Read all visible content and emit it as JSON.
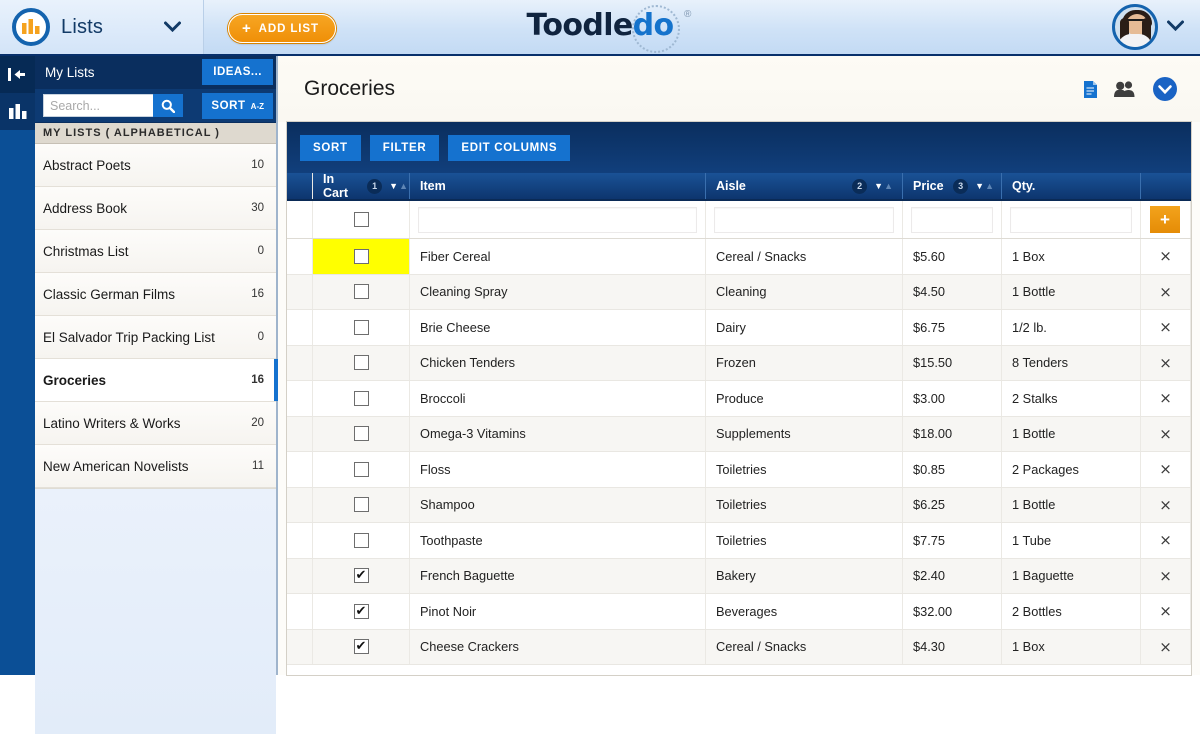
{
  "topbar": {
    "lists_label": "Lists",
    "lists_icon": "bar-chart-icon",
    "caret_icon": "chevron-down-icon",
    "add_list_label": "ADD LIST",
    "add_list_plus": "+",
    "brand_part1": "Toodle",
    "brand_part2": "do",
    "brand_registered": "®",
    "avatar_caret": "chevron-down-icon"
  },
  "rail": {
    "collapse_icon": "collapse-sidebar-icon",
    "charts_icon": "bar-chart-icon"
  },
  "sidebar": {
    "header_title": "My Lists",
    "ideas_label": "IDEAS...",
    "search_placeholder": "Search...",
    "search_value": "",
    "search_icon": "search-icon",
    "sort_label": "SORT",
    "sort_direction": "A-Z",
    "section_label": "MY LISTS ( ALPHABETICAL )",
    "items": [
      {
        "label": "Abstract Poets",
        "count": "10",
        "selected": false
      },
      {
        "label": "Address Book",
        "count": "30",
        "selected": false
      },
      {
        "label": "Christmas List",
        "count": "0",
        "selected": false
      },
      {
        "label": "Classic German Films",
        "count": "16",
        "selected": false
      },
      {
        "label": "El Salvador Trip Packing List",
        "count": "0",
        "selected": false
      },
      {
        "label": "Groceries",
        "count": "16",
        "selected": true
      },
      {
        "label": "Latino Writers & Works",
        "count": "20",
        "selected": false
      },
      {
        "label": "New American Novelists",
        "count": "11",
        "selected": false
      }
    ]
  },
  "main": {
    "page_title": "Groceries",
    "head_icons": [
      {
        "name": "notes-icon"
      },
      {
        "name": "share-people-icon"
      },
      {
        "name": "expand-options-icon"
      }
    ],
    "toolbar": {
      "sort_label": "SORT",
      "filter_label": "FILTER",
      "edit_columns_label": "EDIT COLUMNS"
    },
    "table": {
      "columns": [
        {
          "label": "In Cart",
          "badge": "1",
          "sort": "desc"
        },
        {
          "label": "Item",
          "badge": "",
          "sort": "none"
        },
        {
          "label": "Aisle",
          "badge": "2",
          "sort": "desc"
        },
        {
          "label": "Price",
          "badge": "3",
          "sort": "desc"
        },
        {
          "label": "Qty.",
          "badge": "",
          "sort": "none"
        }
      ],
      "new_row": {
        "item_value": "",
        "aisle_value": "",
        "price_value": "",
        "qty_value": "",
        "checked": false,
        "add_label": "+"
      },
      "delete_glyph": "×",
      "checked_glyph": "✔",
      "rows": [
        {
          "checked": false,
          "highlight": true,
          "item": "Fiber Cereal",
          "aisle": "Cereal / Snacks",
          "price": "$5.60",
          "qty": "1 Box"
        },
        {
          "checked": false,
          "highlight": false,
          "item": "Cleaning Spray",
          "aisle": "Cleaning",
          "price": "$4.50",
          "qty": "1 Bottle"
        },
        {
          "checked": false,
          "highlight": false,
          "item": "Brie Cheese",
          "aisle": "Dairy",
          "price": "$6.75",
          "qty": "1/2 lb."
        },
        {
          "checked": false,
          "highlight": false,
          "item": "Chicken Tenders",
          "aisle": "Frozen",
          "price": "$15.50",
          "qty": "8 Tenders"
        },
        {
          "checked": false,
          "highlight": false,
          "item": "Broccoli",
          "aisle": "Produce",
          "price": "$3.00",
          "qty": "2 Stalks"
        },
        {
          "checked": false,
          "highlight": false,
          "item": "Omega-3 Vitamins",
          "aisle": "Supplements",
          "price": "$18.00",
          "qty": "1 Bottle"
        },
        {
          "checked": false,
          "highlight": false,
          "item": "Floss",
          "aisle": "Toiletries",
          "price": "$0.85",
          "qty": "2 Packages"
        },
        {
          "checked": false,
          "highlight": false,
          "item": "Shampoo",
          "aisle": "Toiletries",
          "price": "$6.25",
          "qty": "1 Bottle"
        },
        {
          "checked": false,
          "highlight": false,
          "item": "Toothpaste",
          "aisle": "Toiletries",
          "price": "$7.75",
          "qty": "1 Tube"
        },
        {
          "checked": true,
          "highlight": false,
          "item": "French Baguette",
          "aisle": "Bakery",
          "price": "$2.40",
          "qty": "1 Baguette"
        },
        {
          "checked": true,
          "highlight": false,
          "item": "Pinot Noir",
          "aisle": "Beverages",
          "price": "$32.00",
          "qty": "2 Bottles"
        },
        {
          "checked": true,
          "highlight": false,
          "item": "Cheese Crackers",
          "aisle": "Cereal / Snacks",
          "price": "$4.30",
          "qty": "1 Box"
        }
      ]
    }
  },
  "colors": {
    "brand_blue": "#1572cf",
    "dark_navy": "#0a2e5e",
    "orange": "#ef8f07",
    "highlight_yellow": "#ffff00"
  }
}
